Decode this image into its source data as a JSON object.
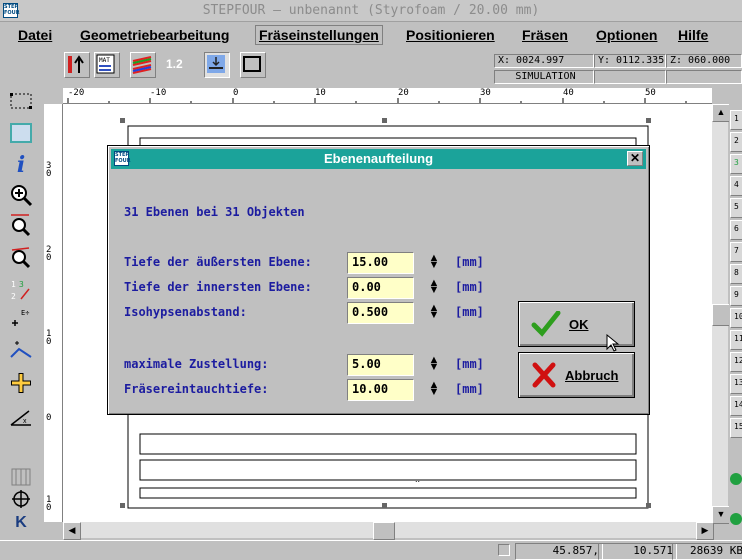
{
  "window": {
    "title": "STEPFOUR – unbenannt (Styrofoam / 20.00 mm)",
    "logo_text": "STEP FOUR"
  },
  "menu": [
    "Datei",
    "Geometriebearbeitung",
    "Fräseinstellungen",
    "Positionieren",
    "Fräsen",
    "Optionen",
    "Hilfe"
  ],
  "toolbar": {
    "tool_mat_label": "MAT",
    "tool_12_label": "1.2",
    "coord_x": "X: 0024.997",
    "coord_y": "Y: 0112.335",
    "coord_z": "Z: 060.000",
    "mode": "SIMULATION"
  },
  "ruler_top": [
    "-20",
    "-10",
    "0",
    "10",
    "20",
    "30",
    "40",
    "50"
  ],
  "ruler_left": [
    "3\n0",
    "2\n0",
    "1\n0",
    "0",
    "1\n0"
  ],
  "right_strip": [
    "1",
    "2",
    "3",
    "4",
    "5",
    "6",
    "7",
    "8",
    "9",
    "10",
    "11",
    "12",
    "13",
    "14",
    "15"
  ],
  "canvas_text": "..",
  "dialog": {
    "title": "Ebenenaufteilung",
    "summary": "31 Ebenen bei 31 Objekten",
    "fields": [
      {
        "label": "Tiefe der äußersten Ebene:",
        "value": "15.00",
        "unit": "[mm]"
      },
      {
        "label": "Tiefe der innersten Ebene:",
        "value": "0.00",
        "unit": "[mm]"
      },
      {
        "label": "Isohypsenabstand:",
        "value": "0.500",
        "unit": "[mm]"
      },
      {
        "label": "maximale Zustellung:",
        "value": "5.00",
        "unit": "[mm]"
      },
      {
        "label": "Fräsereintauchtiefe:",
        "value": "10.00",
        "unit": "[mm]"
      }
    ],
    "ok_label": "OK",
    "cancel_label": "Abbruch"
  },
  "status": {
    "x": "45.857,",
    "y": "10.571",
    "mem": "28639 KB"
  },
  "colors": {
    "dialog_title": "#1ba39a",
    "label_text": "#1c1ca0",
    "field_bg": "#ffffc8",
    "check": "#2e9e1e",
    "cross": "#d01010"
  }
}
